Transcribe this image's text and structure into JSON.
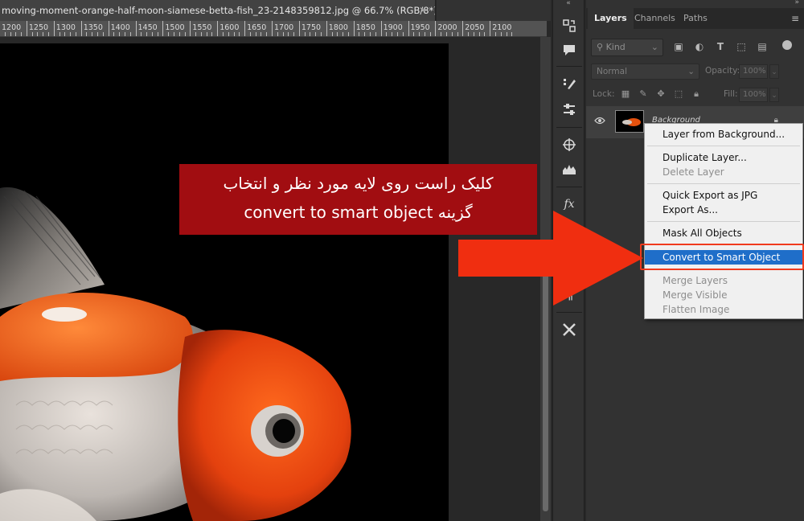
{
  "document": {
    "tab_title": "moving-moment-orange-half-moon-siamese-betta-fish_23-2148359812.jpg @ 66.7% (RGB/8*)",
    "close_glyph": "✕"
  },
  "ruler": {
    "labels": [
      "1200",
      "1250",
      "1300",
      "1350",
      "1400",
      "1450",
      "1500",
      "1550",
      "1600",
      "1650",
      "1700",
      "1750",
      "1800",
      "1850",
      "1900",
      "1950",
      "2000",
      "2050",
      "2100"
    ]
  },
  "panel": {
    "tabs": [
      "Layers",
      "Channels",
      "Paths"
    ],
    "active_tab": "Layers",
    "kind_label": "Kind",
    "blend_mode": "Normal",
    "opacity_label": "Opacity:",
    "opacity_value": "100%",
    "lock_label": "Lock:",
    "fill_label": "Fill:",
    "fill_value": "100%",
    "layer_name": "Background"
  },
  "context_menu": {
    "items": [
      {
        "label": "Layer from Background...",
        "state": "normal"
      },
      {
        "label": "Duplicate Layer...",
        "state": "normal"
      },
      {
        "label": "Delete Layer",
        "state": "disabled"
      },
      {
        "label": "Quick Export as JPG",
        "state": "normal"
      },
      {
        "label": "Export As...",
        "state": "normal"
      },
      {
        "label": "Mask All Objects",
        "state": "normal"
      },
      {
        "label": "Convert to Smart Object",
        "state": "selected"
      },
      {
        "label": "Merge Layers",
        "state": "disabled"
      },
      {
        "label": "Merge Visible",
        "state": "disabled"
      },
      {
        "label": "Flatten Image",
        "state": "disabled"
      }
    ]
  },
  "annotation": {
    "line1": "کلیک راست روی لایه مورد نظر و انتخاب",
    "line2": "convert to smart object گزینه"
  },
  "colors": {
    "callout_bg": "#a10d11",
    "arrow": "#f02e10",
    "menu_selected": "#1f6ec9",
    "highlight_frame": "#f03a1d"
  },
  "icons": {
    "tools": [
      "history-icon",
      "comment-icon",
      "brushes-icon",
      "adjustments-icon",
      "navigator-icon",
      "histogram-icon",
      "fx-icon",
      "paragraph-icon",
      "tools-cross-icon"
    ]
  }
}
